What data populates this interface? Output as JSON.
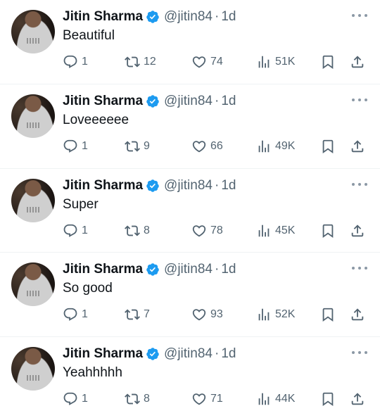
{
  "colors": {
    "text": "#0f1419",
    "secondary": "#536471",
    "verified": "#1d9bf0",
    "divider": "#eff3f4"
  },
  "icons": [
    "verified-badge-icon",
    "more-icon",
    "reply-icon",
    "retweet-icon",
    "like-icon",
    "views-icon",
    "bookmark-icon",
    "share-icon"
  ],
  "tweets": [
    {
      "name": "Jitin Sharma",
      "handle": "@jitin84",
      "sep": "·",
      "time": "1d",
      "text": "Beautiful",
      "replies": "1",
      "retweets": "12",
      "likes": "74",
      "views": "51K"
    },
    {
      "name": "Jitin Sharma",
      "handle": "@jitin84",
      "sep": "·",
      "time": "1d",
      "text": "Loveeeeee",
      "replies": "1",
      "retweets": "9",
      "likes": "66",
      "views": "49K"
    },
    {
      "name": "Jitin Sharma",
      "handle": "@jitin84",
      "sep": "·",
      "time": "1d",
      "text": "Super",
      "replies": "1",
      "retweets": "8",
      "likes": "78",
      "views": "45K"
    },
    {
      "name": "Jitin Sharma",
      "handle": "@jitin84",
      "sep": "·",
      "time": "1d",
      "text": "So good",
      "replies": "1",
      "retweets": "7",
      "likes": "93",
      "views": "52K"
    },
    {
      "name": "Jitin Sharma",
      "handle": "@jitin84",
      "sep": "·",
      "time": "1d",
      "text": "Yeahhhhh",
      "replies": "1",
      "retweets": "8",
      "likes": "71",
      "views": "44K"
    }
  ]
}
